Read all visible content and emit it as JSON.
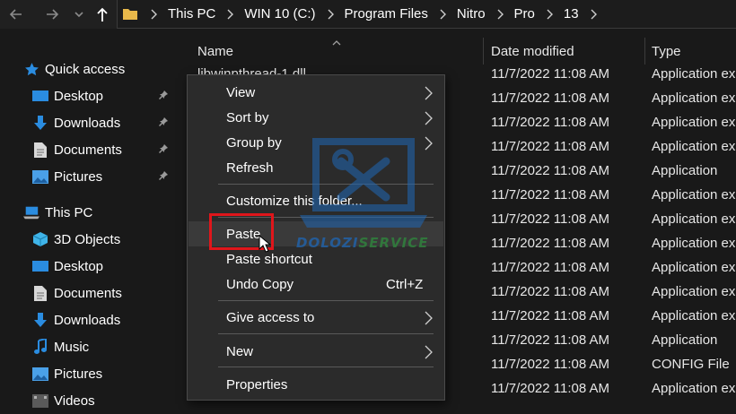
{
  "address_bar": {
    "crumbs": [
      "This PC",
      "WIN 10 (C:)",
      "Program Files",
      "Nitro",
      "Pro",
      "13"
    ]
  },
  "nav": {
    "quick_access": "Quick access",
    "qa_desktop": "Desktop",
    "qa_downloads": "Downloads",
    "qa_documents": "Documents",
    "qa_pictures": "Pictures",
    "this_pc": "This PC",
    "pc_3d": "3D Objects",
    "pc_desktop": "Desktop",
    "pc_documents": "Documents",
    "pc_downloads": "Downloads",
    "pc_music": "Music",
    "pc_pictures": "Pictures",
    "pc_videos": "Videos"
  },
  "columns": {
    "name": "Name",
    "date": "Date modified",
    "type": "Type"
  },
  "rows": [
    {
      "name": "libwinpthread-1.dll",
      "date": "11/7/2022 11:08 AM",
      "type": "Application ex"
    },
    {
      "name": "",
      "date": "11/7/2022 11:08 AM",
      "type": "Application ex"
    },
    {
      "name": "",
      "date": "11/7/2022 11:08 AM",
      "type": "Application ex"
    },
    {
      "name": "",
      "date": "11/7/2022 11:08 AM",
      "type": "Application ex"
    },
    {
      "name": "",
      "date": "11/7/2022 11:08 AM",
      "type": "Application"
    },
    {
      "name": "",
      "date": "11/7/2022 11:08 AM",
      "type": "Application ex"
    },
    {
      "name": "",
      "date": "11/7/2022 11:08 AM",
      "type": "Application ex"
    },
    {
      "name": "",
      "date": "11/7/2022 11:08 AM",
      "type": "Application ex"
    },
    {
      "name": "",
      "date": "11/7/2022 11:08 AM",
      "type": "Application ex"
    },
    {
      "name": "",
      "date": "11/7/2022 11:08 AM",
      "type": "Application ex"
    },
    {
      "name": "",
      "date": "11/7/2022 11:08 AM",
      "type": "Application ex"
    },
    {
      "name": "",
      "date": "11/7/2022 11:08 AM",
      "type": "Application"
    },
    {
      "name": "",
      "date": "11/7/2022 11:08 AM",
      "type": "CONFIG File"
    },
    {
      "name": "",
      "date": "11/7/2022 11:08 AM",
      "type": "Application ex"
    }
  ],
  "context_menu": {
    "view": "View",
    "sort_by": "Sort by",
    "group_by": "Group by",
    "refresh": "Refresh",
    "customize": "Customize this folder...",
    "paste": "Paste",
    "paste_shortcut": "Paste shortcut",
    "undo_copy": "Undo Copy",
    "undo_shortcut": "Ctrl+Z",
    "give_access": "Give access to",
    "new": "New",
    "properties": "Properties"
  },
  "watermark": {
    "brand": "DOLOZI",
    "suffix": "SERVICE"
  },
  "colors": {
    "highlight_box": "#e0161b",
    "accent_blue": "#2a8ce0"
  }
}
